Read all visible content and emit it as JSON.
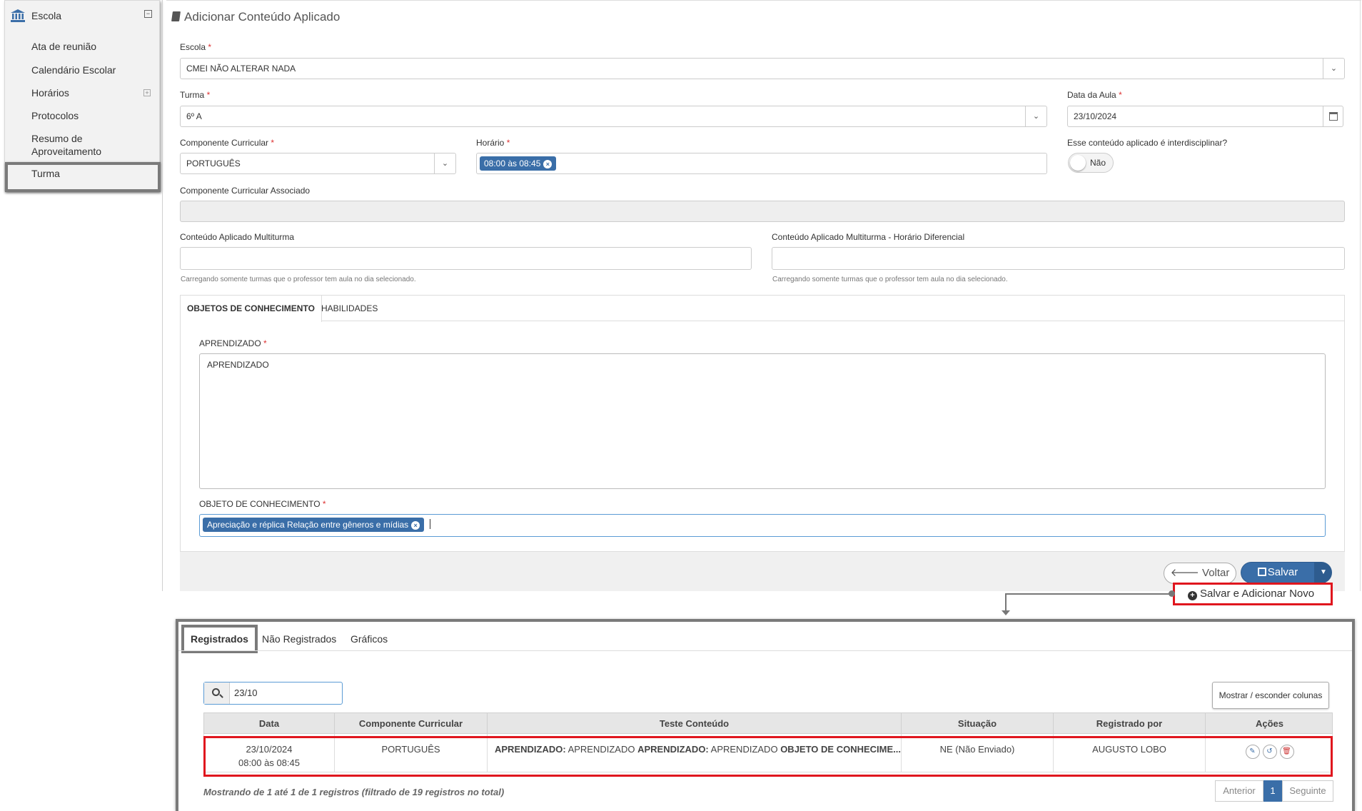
{
  "sidebar": {
    "header": "Escola",
    "items": [
      {
        "label": "Ata de reunião"
      },
      {
        "label": "Calendário Escolar"
      },
      {
        "label": "Horários"
      },
      {
        "label": "Protocolos"
      },
      {
        "label": "Resumo de Aproveitamento"
      },
      {
        "label": "Turma"
      }
    ]
  },
  "form": {
    "title": "Adicionar Conteúdo Aplicado",
    "escola": {
      "label": "Escola",
      "value": "CMEI NÃO ALTERAR NADA"
    },
    "turma": {
      "label": "Turma",
      "value": "6º A"
    },
    "data_aula": {
      "label": "Data da Aula",
      "value": "23/10/2024"
    },
    "componente": {
      "label": "Componente Curricular",
      "value": "PORTUGUÊS"
    },
    "horario": {
      "label": "Horário",
      "tag": "08:00 às 08:45"
    },
    "interdisciplinar": {
      "label": "Esse conteúdo aplicado é interdisciplinar?",
      "value": "Não"
    },
    "associado": {
      "label": "Componente Curricular Associado"
    },
    "multiturma": {
      "label": "Conteúdo Aplicado Multiturma",
      "hint": "Carregando somente turmas que o professor tem aula no dia selecionado."
    },
    "multiturma_diferencial": {
      "label": "Conteúdo Aplicado Multiturma - Horário Diferencial",
      "hint": "Carregando somente turmas que o professor tem aula no dia selecionado."
    },
    "tabs": [
      {
        "label": "OBJETOS DE CONHECIMENTO"
      },
      {
        "label": "HABILIDADES"
      }
    ],
    "aprendizado": {
      "label": "APRENDIZADO",
      "value": "APRENDIZADO"
    },
    "objeto": {
      "label": "OBJETO DE CONHECIMENTO",
      "tag": "Apreciação e réplica Relação entre gêneros e mídias"
    },
    "buttons": {
      "voltar": "Voltar",
      "salvar": "Salvar",
      "salvar_novo": "Salvar e Adicionar Novo"
    }
  },
  "list": {
    "tabs": [
      {
        "label": "Registrados"
      },
      {
        "label": "Não Registrados"
      },
      {
        "label": "Gráficos"
      }
    ],
    "search_value": "23/10",
    "columns_button": "Mostrar / esconder colunas",
    "columns": [
      "Data",
      "Componente Curricular",
      "Teste Conteúdo",
      "Situação",
      "Registrado por",
      "Ações"
    ],
    "row": {
      "data": "23/10/2024",
      "horario": "08:00 às 08:45",
      "componente": "PORTUGUÊS",
      "conteudo_l1": "APRENDIZADO:",
      "conteudo_v1": " APRENDIZADO ",
      "conteudo_l2": "APRENDIZADO:",
      "conteudo_v2": " APRENDIZADO ",
      "conteudo_l3": "OBJETO DE CONHECIME...",
      "situacao": "NE (Não Enviado)",
      "registrado_por": "AUGUSTO LOBO"
    },
    "footer_info": "Mostrando de 1 até 1 de 1 registros (filtrado de 19 registros no total)",
    "pagination": {
      "prev": "Anterior",
      "page": "1",
      "next": "Seguinte"
    }
  },
  "colors": {
    "primary": "#3a6ea8",
    "highlight_red": "#e0161e",
    "highlight_gray": "#7a7a7a"
  }
}
